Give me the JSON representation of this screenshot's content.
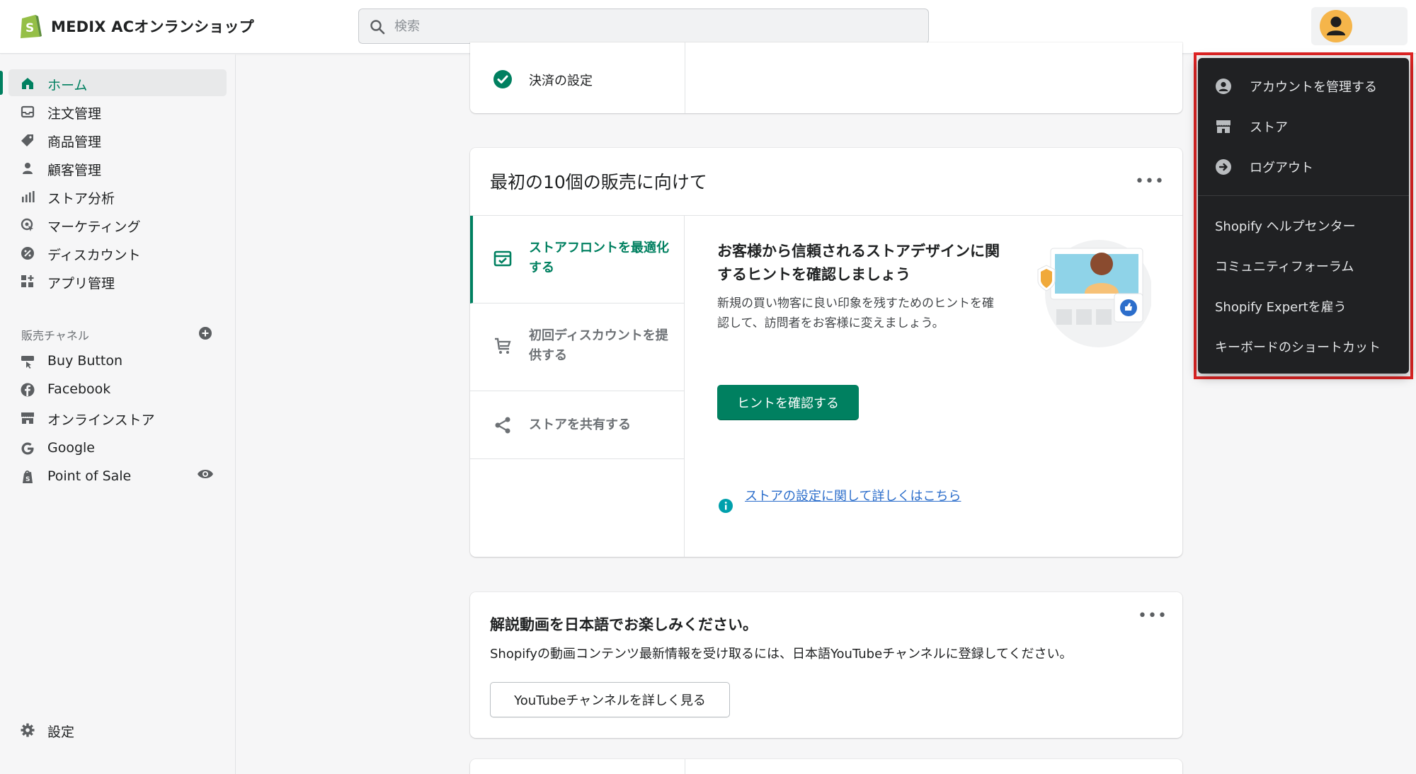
{
  "app": {
    "store_name": "MEDIX ACオンランショップ",
    "brand_color": "#008060"
  },
  "search": {
    "placeholder": "検索",
    "icon": "search-icon"
  },
  "sidebar": {
    "items": [
      {
        "label": "ホーム",
        "icon": "home-icon",
        "active": true
      },
      {
        "label": "注文管理",
        "icon": "orders-icon"
      },
      {
        "label": "商品管理",
        "icon": "tag-icon"
      },
      {
        "label": "顧客管理",
        "icon": "customer-icon"
      },
      {
        "label": "ストア分析",
        "icon": "analytics-icon"
      },
      {
        "label": "マーケティング",
        "icon": "marketing-icon"
      },
      {
        "label": "ディスカウント",
        "icon": "discount-icon"
      },
      {
        "label": "アプリ管理",
        "icon": "apps-icon"
      }
    ],
    "sales_channels_title": "販売チャネル",
    "channels": [
      {
        "label": "Buy Button",
        "icon": "buy-button-icon"
      },
      {
        "label": "Facebook",
        "icon": "facebook-icon"
      },
      {
        "label": "オンラインストア",
        "icon": "online-store-icon"
      },
      {
        "label": "Google",
        "icon": "google-icon"
      },
      {
        "label": "Point of Sale",
        "icon": "pos-icon"
      }
    ],
    "settings_label": "設定"
  },
  "main": {
    "payment_setup": "決済の設定",
    "first_sales": {
      "title": "最初の10個の販売に向けて",
      "tabs": [
        {
          "label": "ストアフロントを最適化する",
          "active": true
        },
        {
          "label": "初回ディスカウントを提供する"
        },
        {
          "label": "ストアを共有する"
        }
      ],
      "tip_title": "お客様から信頼されるストアデザインに関するヒントを確認しましょう",
      "tip_body": "新規の買い物客に良い印象を残すためのヒントを確認して、訪問者をお客様に変えましょう。",
      "tip_button": "ヒントを確認する",
      "learn_link": "ストアの設定に関して詳しくはこちら"
    },
    "video": {
      "title": "解説動画を日本語でお楽しみください。",
      "body": "Shopifyの動画コンテンツ最新情報を受け取るには、日本語YouTubeチャンネルに登録してください。",
      "button": "YouTubeチャンネルを詳しく見る"
    }
  },
  "dropdown": {
    "account_items": [
      {
        "label": "アカウントを管理する",
        "icon": "account-icon"
      },
      {
        "label": "ストア",
        "icon": "store-icon"
      },
      {
        "label": "ログアウト",
        "icon": "logout-icon"
      }
    ],
    "help_items": [
      {
        "label": "Shopify ヘルプセンター"
      },
      {
        "label": "コミュニティフォーラム"
      },
      {
        "label": "Shopify Expertを雇う"
      },
      {
        "label": "キーボードのショートカット"
      }
    ]
  }
}
